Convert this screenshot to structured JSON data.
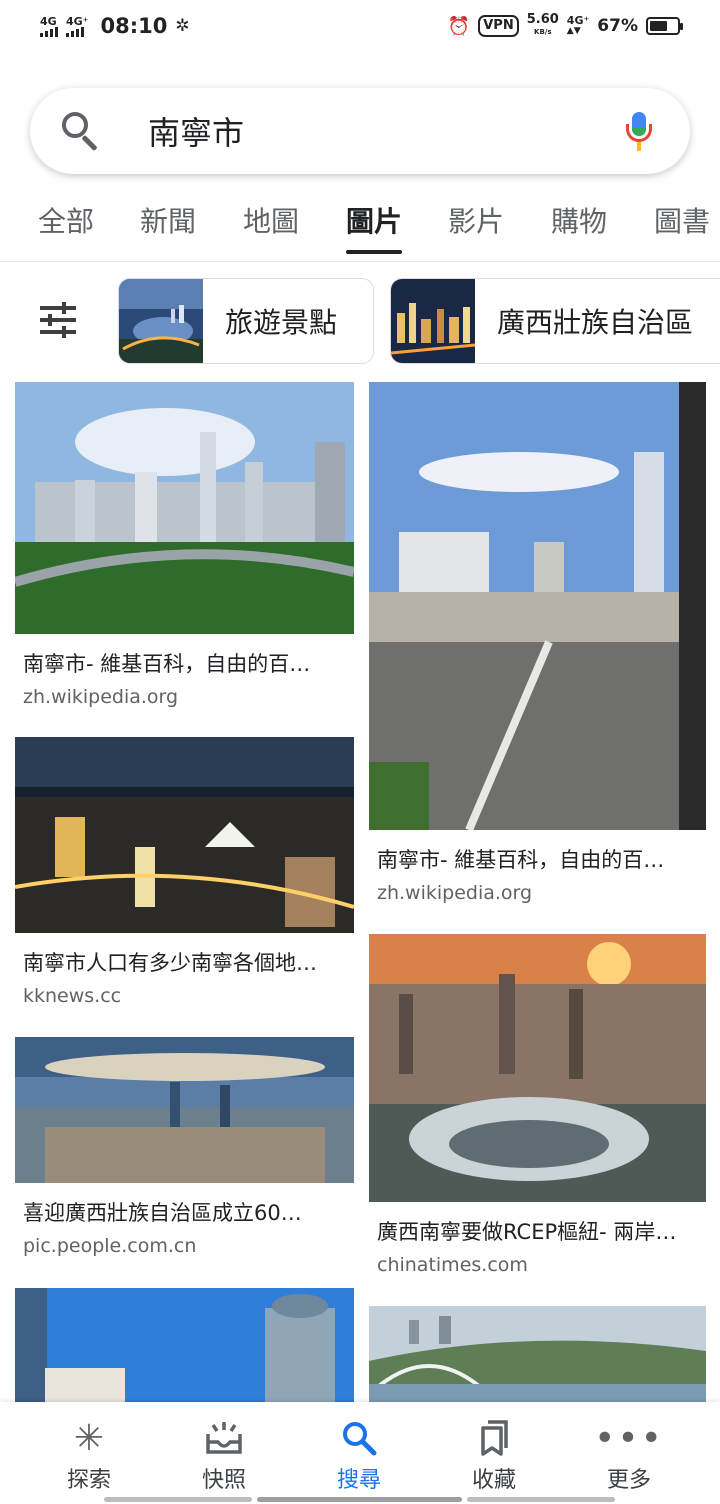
{
  "status_bar": {
    "signal1": "4G",
    "signal2": "4G⁺",
    "time": "08:10",
    "settings_icon": "gear-icon",
    "alarm_icon": "alarm-clock-icon",
    "vpn": "VPN",
    "net_speed": "5.60",
    "net_speed_unit": "KB/s",
    "signal3": "4G⁺",
    "battery_pct": "67%",
    "battery_level": 0.67
  },
  "search": {
    "query": "南寧市",
    "search_icon": "search-icon",
    "mic_icon": "google-mic-icon"
  },
  "tabs": [
    {
      "label": "全部",
      "active": false
    },
    {
      "label": "新聞",
      "active": false
    },
    {
      "label": "地圖",
      "active": false
    },
    {
      "label": "圖片",
      "active": true
    },
    {
      "label": "影片",
      "active": false
    },
    {
      "label": "購物",
      "active": false
    },
    {
      "label": "圖書",
      "active": false
    }
  ],
  "filters": {
    "filter_icon": "tune-icon",
    "chips": [
      {
        "label": "旅遊景點"
      },
      {
        "label": "廣西壯族自治區"
      }
    ]
  },
  "results": {
    "left_column": [
      {
        "title": "南寧市- 維基百科，自由的百…",
        "site": "zh.wikipedia.org"
      },
      {
        "title": "南寧市人口有多少南寧各個地…",
        "site": "kknews.cc"
      },
      {
        "title": "喜迎廣西壯族自治區成立60…",
        "site": "pic.people.com.cn"
      },
      {
        "title": "",
        "site": ""
      }
    ],
    "right_column": [
      {
        "title": "南寧市- 維基百科，自由的百…",
        "site": "zh.wikipedia.org"
      },
      {
        "title": "廣西南寧要做RCEP樞紐- 兩岸…",
        "site": "chinatimes.com"
      },
      {
        "title": "",
        "site": ""
      }
    ]
  },
  "bottom_nav": [
    {
      "label": "探索",
      "icon": "asterisk-icon",
      "active": false
    },
    {
      "label": "快照",
      "icon": "inbox-icon",
      "active": false
    },
    {
      "label": "搜尋",
      "icon": "search-icon",
      "active": true
    },
    {
      "label": "收藏",
      "icon": "bookmarks-icon",
      "active": false
    },
    {
      "label": "更多",
      "icon": "more-horizontal-icon",
      "active": false
    }
  ],
  "colors": {
    "accent": "#1a73e8",
    "text": "#202124",
    "secondary_text": "#5f6368"
  }
}
